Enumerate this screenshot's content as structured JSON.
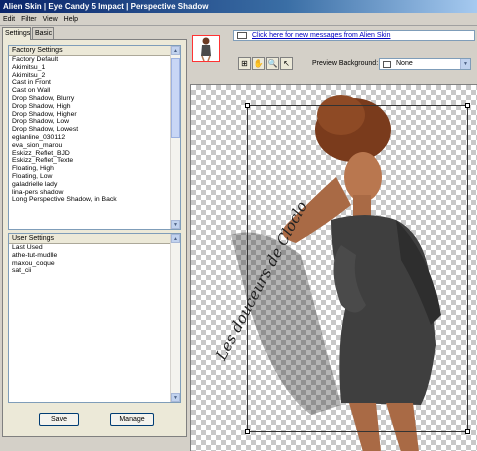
{
  "window": {
    "title": "Alien Skin | Eye Candy 5 Impact | Perspective Shadow"
  },
  "menu": {
    "items": [
      "Edit",
      "Filter",
      "View",
      "Help"
    ]
  },
  "tabs": [
    {
      "label": "Settings"
    },
    {
      "label": "Basic"
    }
  ],
  "factory": {
    "header": "Factory Settings",
    "items": [
      "Factory Default",
      "Akimitsu_1",
      "Akimitsu_2",
      "Cast in Front",
      "Cast on Wall",
      "Drop Shadow, Blurry",
      "Drop Shadow, High",
      "Drop Shadow, Higher",
      "Drop Shadow, Low",
      "Drop Shadow, Lowest",
      "eglanline_030112",
      "eva_sion_marou",
      "Eskizz_Reflet_BJD",
      "Eskizz_Reflet_Texte",
      "Floating, High",
      "Floating, Low",
      "galadrielle lady",
      "lina-pers shadow",
      "Long Perspective Shadow, in Back"
    ]
  },
  "user": {
    "header": "User Settings",
    "items": [
      "Last Used",
      "athe-tut-mudlle",
      "maxou_coque",
      "sat_cii"
    ]
  },
  "buttons": {
    "save": "Save",
    "manage": "Manage"
  },
  "message_link": "Click here for new messages from Alien Skin",
  "preview_background": {
    "label": "Preview Background:",
    "value": "None"
  },
  "watermark": "Les douceurs de Cloclo"
}
